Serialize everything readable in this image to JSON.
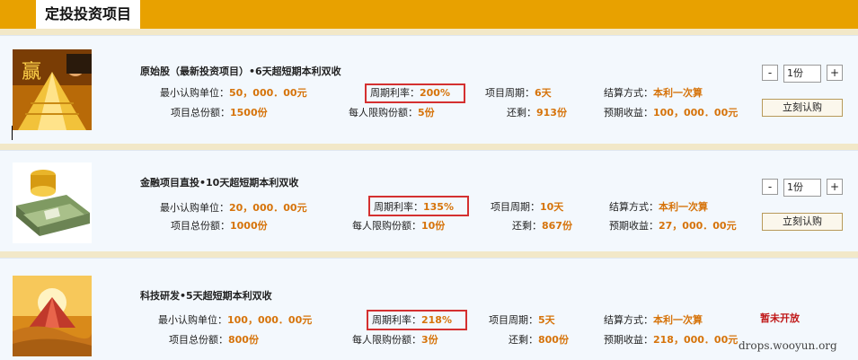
{
  "header": {
    "title": "定投投资项目"
  },
  "labels": {
    "min_unit": "最小认购单位：",
    "cycle_rate": "周期利率：",
    "cycle": "项目周期：",
    "settle": "结算方式：",
    "total_shares": "项目总份额：",
    "per_person": "每人限购份额：",
    "remaining": "还剩：",
    "expected": "预期收益："
  },
  "stepper": {
    "minus": "-",
    "plus": "+"
  },
  "buy_label": "立刻认购",
  "closed_label": "暂未开放",
  "products": [
    {
      "title": "原始股（最新投资项目）•6天超短期本利双收",
      "min_unit": "50，000．00元",
      "cycle_rate": "200%",
      "cycle": "6天",
      "settle": "本利一次算",
      "total_shares": "1500份",
      "per_person": "5份",
      "remaining": "913份",
      "expected": "100，000．00元",
      "qty": "1份",
      "thumb_icon": "gold-pyramid-icon"
    },
    {
      "title": "金融项目直投•10天超短期本利双收",
      "min_unit": "20，000．00元",
      "cycle_rate": "135%",
      "cycle": "10天",
      "settle": "本利一次算",
      "total_shares": "1000份",
      "per_person": "10份",
      "remaining": "867份",
      "expected": "27，000．00元",
      "qty": "1份",
      "thumb_icon": "money-stack-icon"
    },
    {
      "title": "科技研发•5天超短期本利双收",
      "min_unit": "100，000．00元",
      "cycle_rate": "218%",
      "cycle": "5天",
      "settle": "本利一次算",
      "total_shares": "800份",
      "per_person": "3份",
      "remaining": "800份",
      "expected": "218，000．00元",
      "thumb_icon": "desert-pyramid-icon"
    }
  ],
  "watermark": "drops.wooyun.org",
  "colors": {
    "header": "#e8a100",
    "value": "#d6730a",
    "highlight": "#d43030",
    "closed": "#c01818"
  }
}
